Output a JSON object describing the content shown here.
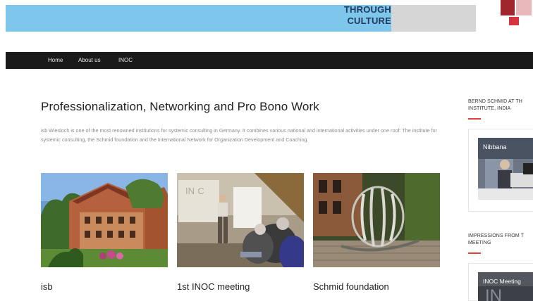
{
  "banner": {
    "text_line1": "THROUGH",
    "text_line2": "CULTURE",
    "blue": "#7fc6ec",
    "gray": "#d6d6d6"
  },
  "nav": {
    "items": [
      "Home",
      "About us",
      "INOC"
    ]
  },
  "main": {
    "title": "Professionalization, Networking and Pro Bono Work",
    "intro": "isb Wiesloch is one of the most renowned institutions for systemic consulting in Germany. It combines various national and international activities under one roof: The institute for systemic consulting, the Schmid foundation and the International Network for Organization Development and Coaching.",
    "cards": [
      {
        "title": "isb"
      },
      {
        "title": "1st INOC meeting",
        "photo_text": "IN C"
      },
      {
        "title": "Schmid foundation"
      }
    ]
  },
  "sidebar": {
    "section1": {
      "heading": "BERND SCHMID AT TH INSTITUTE, INDIA",
      "video_title": "Nibbana"
    },
    "section2": {
      "heading": "IMPRESSIONS FROM T MEETING",
      "video_title": "INOC Meeting"
    }
  },
  "colors": {
    "navbar": "#1a1a1a",
    "accent_red": "#e2413a",
    "logo_dark_red": "#a0262e"
  }
}
